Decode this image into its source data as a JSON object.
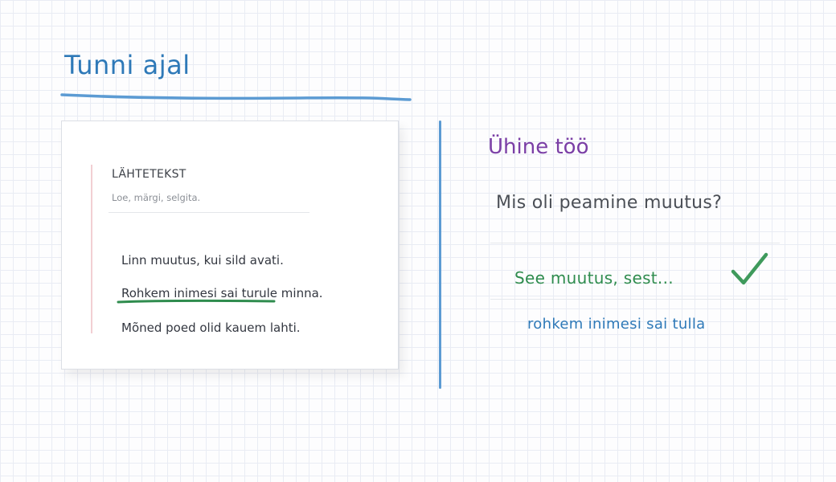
{
  "header": {
    "title": "Tunni ajal"
  },
  "source_card": {
    "label": "LÄHTETEKST",
    "subtitle": "Loe, märgi, selgita.",
    "lines": [
      "Linn muutus, kui sild avati.",
      "Rohkem inimesi sai turule minna.",
      "Mõned poed olid kauem lahti."
    ],
    "line2_highlight": "Rohkem inimesi sai turule",
    "line2_rest": " minna."
  },
  "work_panel": {
    "title": "Ühine töö",
    "question": "Mis oli peamine muutus?",
    "answer_start": "See muutus, sest...",
    "answer_continuation": "rohkem inimesi sai tulla",
    "check_icon": "check-icon"
  },
  "colors": {
    "title_blue": "#2e79b8",
    "section_purple": "#7b3fa6",
    "answer_green": "#2f8c4e",
    "divider_blue": "#5c9bd3"
  }
}
